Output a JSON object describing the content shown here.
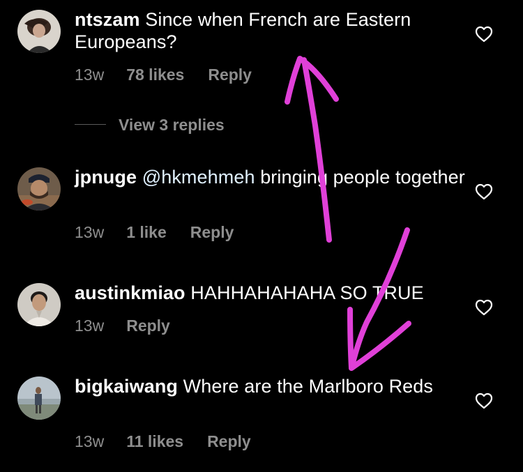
{
  "colors": {
    "background": "#000000",
    "text": "#ffffff",
    "secondary": "#8e8e8e",
    "annotation": "#e040d8"
  },
  "comments": [
    {
      "username": "ntszam",
      "text": "Since when French are Eastern Europeans?",
      "time": "13w",
      "likes": "78 likes",
      "reply": "Reply",
      "view_replies": "View 3 replies"
    },
    {
      "username": "jpnuge",
      "mention": "@hkmehmeh",
      "text": "bringing people together",
      "time": "13w",
      "likes": "1 like",
      "reply": "Reply"
    },
    {
      "username": "austinkmiao",
      "text": "HAHHAHAHAHA SO TRUE",
      "time": "13w",
      "reply": "Reply"
    },
    {
      "username": "bigkaiwang",
      "text": "Where are the Marlboro Reds",
      "time": "13w",
      "likes": "11 likes",
      "reply": "Reply"
    }
  ],
  "icons": {
    "like": "heart-outline-icon"
  }
}
